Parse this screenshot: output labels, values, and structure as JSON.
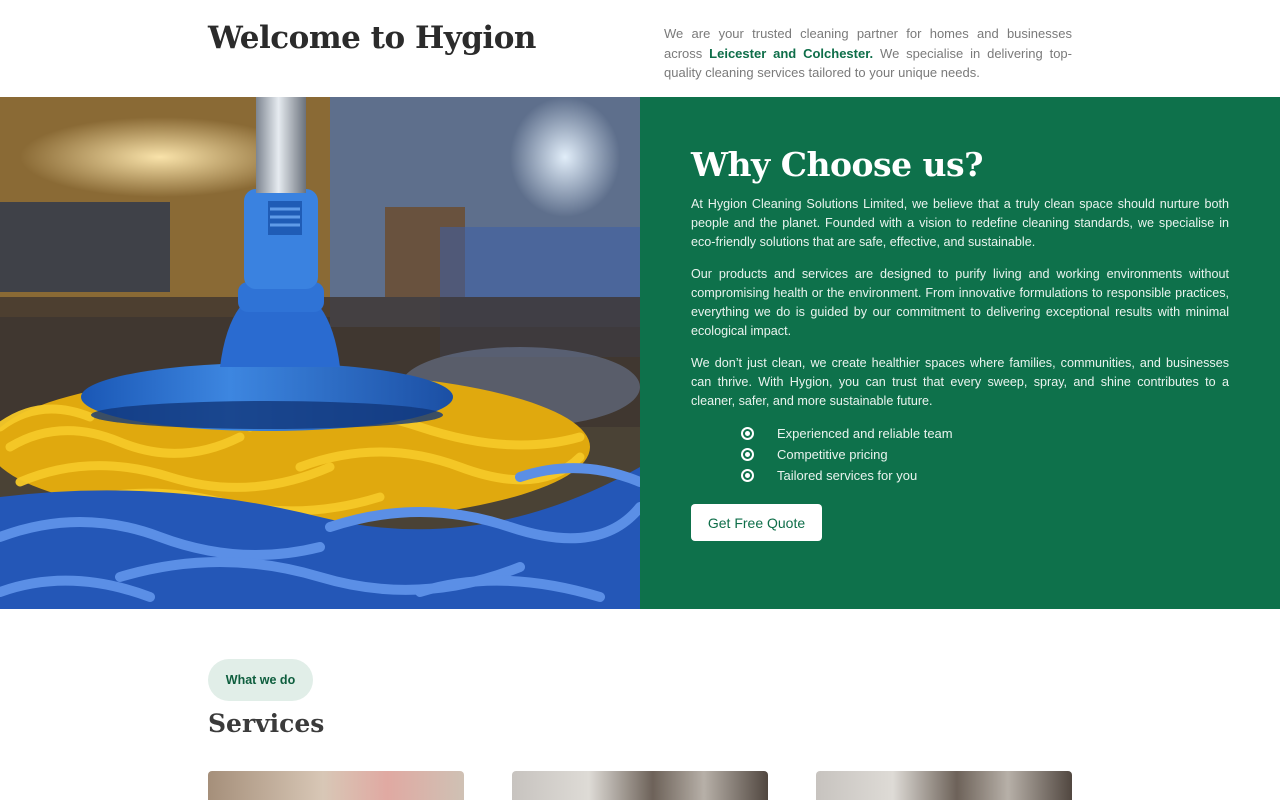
{
  "intro": {
    "title": "Welcome to Hygion",
    "text_before": "We are your trusted cleaning partner for homes and businesses across ",
    "highlight": "Leicester and Colchester.",
    "text_after": " We specialise in delivering top-quality cleaning services tailored to your unique needs."
  },
  "hero": {
    "image_alt": "Close-up of a blue and yellow mop on a floor",
    "heading": "Why Choose us?",
    "paragraphs": [
      "At Hygion Cleaning Solutions Limited, we believe that a truly clean space should nurture both people and the planet. Founded with a vision to redefine cleaning standards, we specialise in eco-friendly solutions that are safe, effective, and sustainable.",
      "Our products and services are designed to purify living and working environments without compromising health or the environment. From innovative formulations to responsible practices, everything we do is guided by our commitment to delivering exceptional results with minimal ecological impact.",
      "We don’t just clean, we create healthier spaces where families, communities, and businesses can thrive. With Hygion, you can trust that every sweep, spray, and shine contributes to a cleaner, safer, and more sustainable future."
    ],
    "features": [
      "Experienced and reliable team",
      "Competitive pricing",
      "Tailored services for you"
    ],
    "cta_label": "Get Free Quote"
  },
  "services": {
    "tag": "What we do",
    "heading": "Services"
  },
  "colors": {
    "brand_green": "#0e714b",
    "pill_bg": "#e1eee8"
  }
}
